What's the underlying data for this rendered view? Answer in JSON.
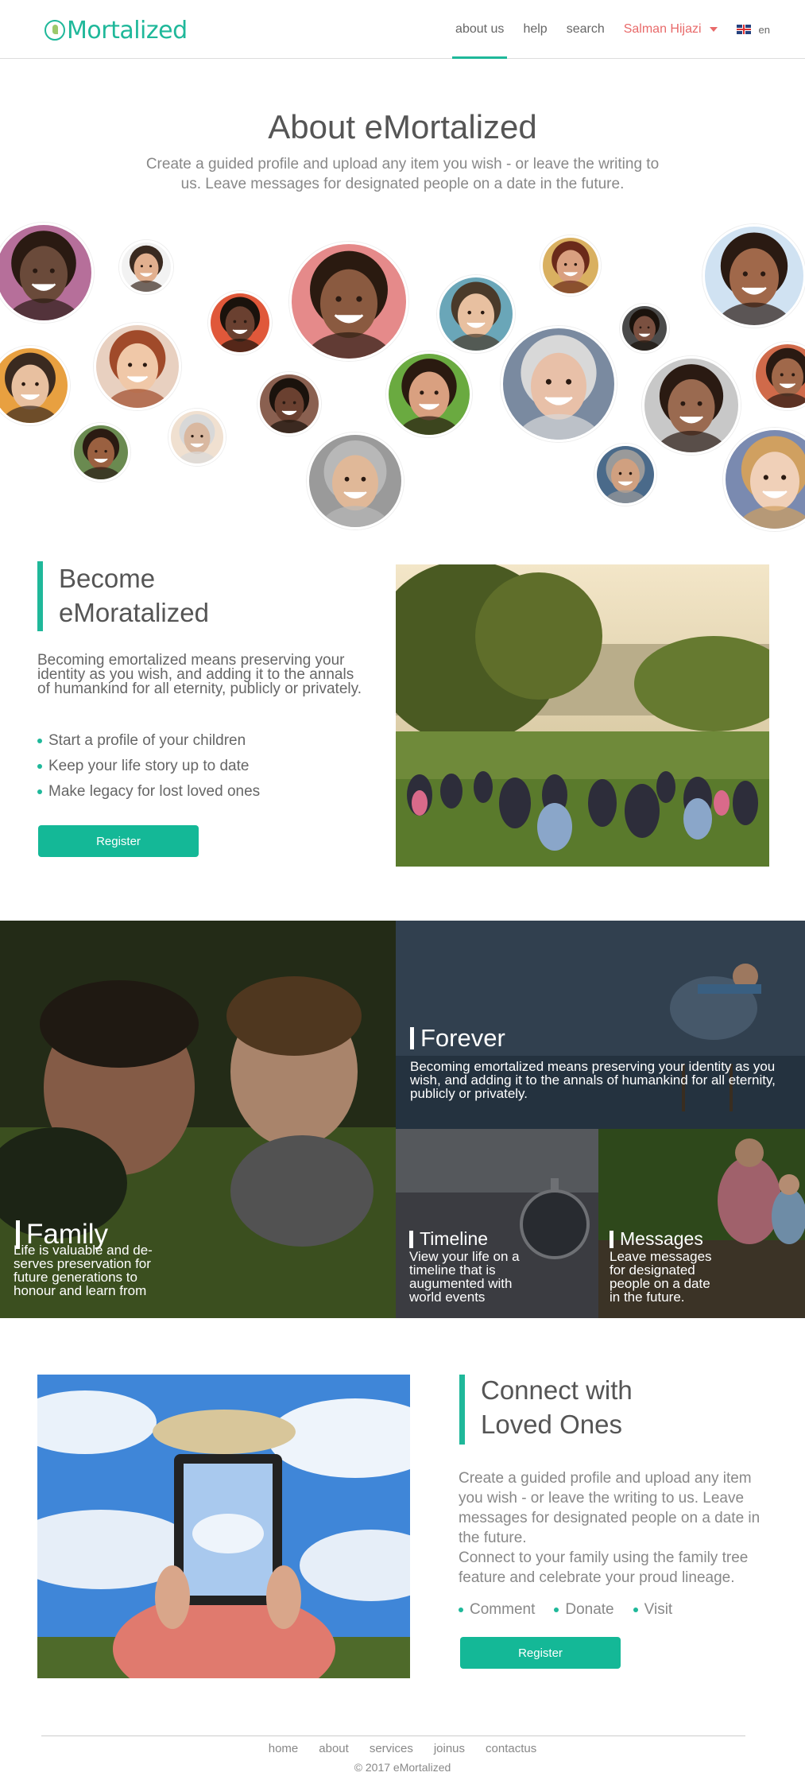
{
  "header": {
    "logo_text": "Mortalized",
    "nav": [
      {
        "label": "about us",
        "active": true
      },
      {
        "label": "help",
        "active": false
      },
      {
        "label": "search",
        "active": false
      }
    ],
    "user_name": "Salman Hijazi",
    "language": "en",
    "accent_color": "#1fb89a"
  },
  "hero": {
    "title": "About eMortalized",
    "subtitle": "Create a guided profile and upload any item you wish - or leave the writing to us. Leave messages for designated people on a date in the future."
  },
  "become": {
    "title_line1": "Become",
    "title_line2": "eMoratalized",
    "description": "Becoming emortalized means preserving your identity as you wish, and adding it to the annals of humankind for all eternity, publicly or privately.",
    "bullets": [
      "Start a profile of your children",
      "Keep your life story up to date",
      "Make legacy for lost loved ones"
    ],
    "button_label": "Register"
  },
  "tiles": {
    "family": {
      "title": "Family",
      "text": "Life is valuable and de-serves preservation for future generations to honour and learn from"
    },
    "forever": {
      "title": "Forever",
      "text": "Becoming emortalized means preserving your identity as you wish, and adding it to the annals of humankind for all eternity, publicly or privately."
    },
    "timeline": {
      "title": "Timeline",
      "text": "View your life on a timeline that is augumented with world events"
    },
    "messages": {
      "title": "Messages",
      "text": "Leave messages for designated people on a date in the future."
    }
  },
  "connect": {
    "title_line1": "Connect with",
    "title_line2": "Loved Ones",
    "paragraph1": "Create a guided profile and upload any item you wish - or leave the writing to us. Leave messages for designated people on a date in the future.",
    "paragraph2": "Connect to your family using the family tree feature and celebrate your proud lineage.",
    "bullets": [
      "Comment",
      "Donate",
      "Visit"
    ],
    "button_label": "Register"
  },
  "footer": {
    "links": [
      "home",
      "about",
      "services",
      "joinus",
      "contactus"
    ],
    "copyright": "© 2017 eMortalized"
  }
}
